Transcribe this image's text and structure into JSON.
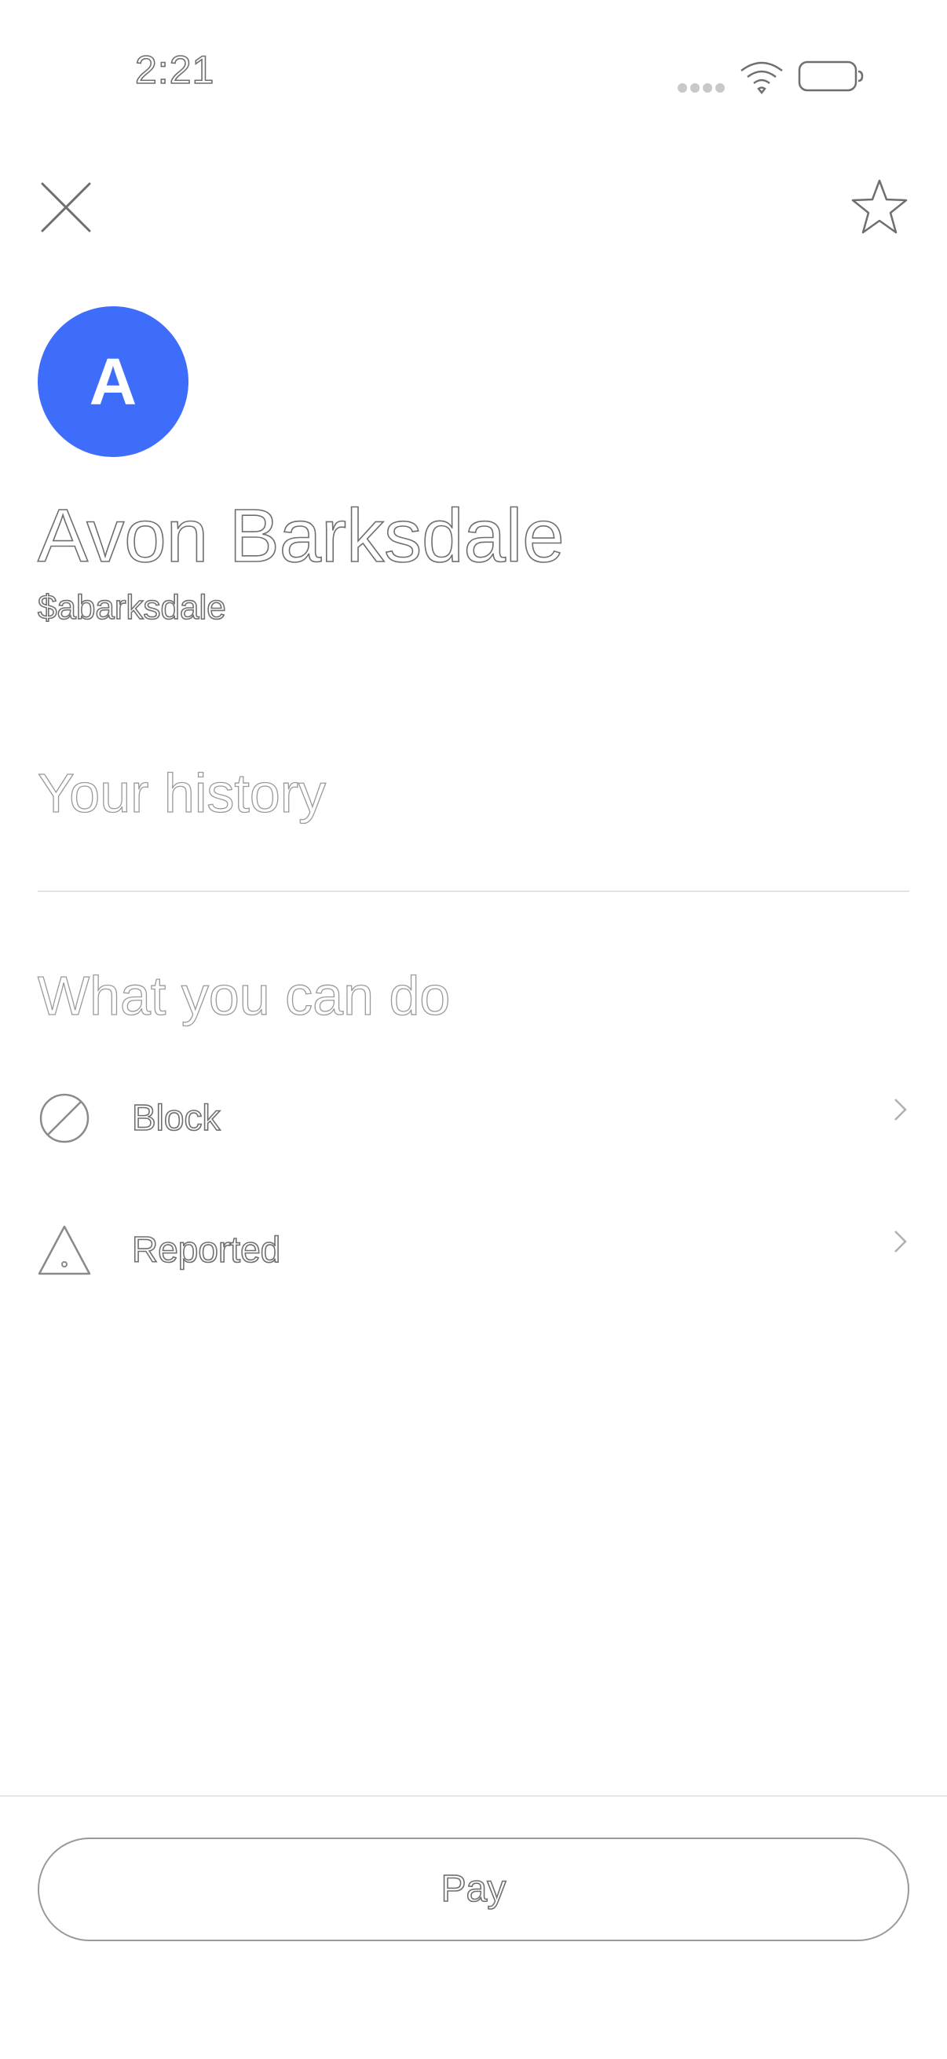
{
  "status_bar": {
    "time": "2:21"
  },
  "header": {
    "close_icon": "close-icon",
    "favorite_icon": "star-icon"
  },
  "profile": {
    "avatar_letter": "A",
    "avatar_color": "#3f6dfb",
    "name": "Avon Barksdale",
    "handle": "$abarksdale"
  },
  "sections": {
    "history_title": "Your history",
    "actions_title": "What you can do"
  },
  "actions": [
    {
      "label": "Block",
      "icon": "block-icon"
    },
    {
      "label": "Reported",
      "icon": "warning-icon"
    }
  ],
  "footer": {
    "pay_label": "Pay"
  }
}
